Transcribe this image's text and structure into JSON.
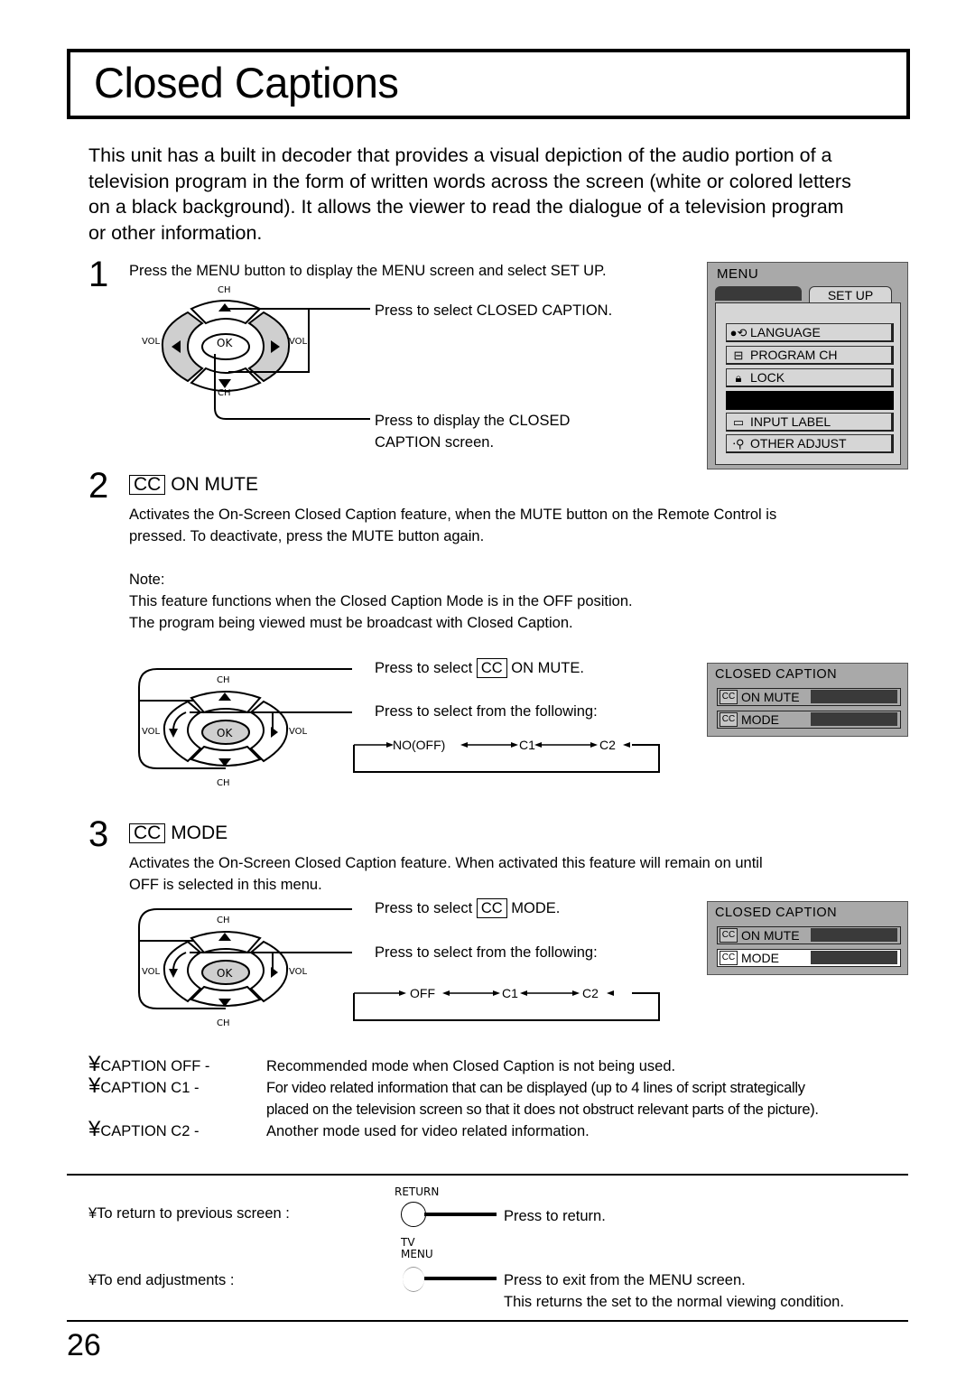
{
  "page": {
    "title": "Closed Captions",
    "intro": "This unit has a built in decoder that provides a visual depiction of the audio portion of a television program in the form of written words across the screen (white or colored letters on a black background). It allows the viewer to read the dialogue of a television program or other information.",
    "page_number": "26"
  },
  "step1": {
    "number": "1",
    "text": "Press the MENU button to display the MENU screen and select SET UP.",
    "callout_select": "Press to select CLOSED CAPTION.",
    "callout_display_line1": "Press to display the CLOSED",
    "callout_display_line2": "CAPTION screen.",
    "remote": {
      "ch_up": "CH",
      "ch_down": "CH",
      "vol_left": "VOL",
      "vol_right": "VOL",
      "ok": "OK"
    },
    "menu_screen": {
      "title": "MENU",
      "active_tab": "SET UP",
      "items": [
        {
          "icon": "language-icon",
          "label": "LANGUAGE"
        },
        {
          "icon": "program-ch-icon",
          "label": "PROGRAM  CH"
        },
        {
          "icon": "lock-icon",
          "label": "LOCK"
        },
        {
          "icon": "",
          "label": ""
        },
        {
          "icon": "input-label-icon",
          "label": "INPUT  LABEL"
        },
        {
          "icon": "other-adjust-icon",
          "label": "OTHER  ADJUST"
        }
      ]
    }
  },
  "step2": {
    "number": "2",
    "cc": "CC",
    "heading": "ON MUTE",
    "desc_line1": "Activates the On-Screen Closed Caption feature, when the MUTE button on the Remote Control is",
    "desc_line2": "pressed. To deactivate, press the MUTE button again.",
    "note_label": "Note:",
    "note_line1": "This feature functions when the Closed Caption Mode is in the  OFF  position.",
    "note_line2": "The program being viewed must be broadcast with Closed Caption.",
    "callout_select_prefix": "Press to select",
    "callout_select_suffix": "ON MUTE.",
    "callout_options": "Press to select from the following:",
    "cycle": [
      "NO(OFF)",
      "C1",
      "C2"
    ],
    "osd": {
      "title": "CLOSED  CAPTION",
      "rows": [
        {
          "icon": "cc",
          "label": "ON MUTE",
          "selected": false
        },
        {
          "icon": "cc",
          "label": "MODE",
          "selected": false
        }
      ]
    }
  },
  "step3": {
    "number": "3",
    "cc": "CC",
    "heading": "MODE",
    "desc_line1": "Activates the On-Screen Closed Caption feature. When activated this feature will remain on until",
    "desc_line2": "OFF is selected in this menu.",
    "callout_select_prefix": "Press to select",
    "callout_select_suffix": "MODE.",
    "callout_options": "Press to select from the following:",
    "cycle": [
      "OFF",
      "C1",
      "C2"
    ],
    "osd": {
      "title": "CLOSED  CAPTION",
      "rows": [
        {
          "icon": "cc",
          "label": "ON MUTE",
          "selected": false
        },
        {
          "icon": "cc",
          "label": "MODE",
          "selected": true
        }
      ]
    }
  },
  "modes": [
    {
      "bullet": "¥",
      "term": "CAPTION OFF -",
      "desc": "Recommended mode when Closed Caption is not being used."
    },
    {
      "bullet": "¥",
      "term": "CAPTION C1 -",
      "desc": "For video related information that can be displayed (up to 4 lines of script strategically",
      "desc2": "placed on the television screen so that it does not obstruct relevant parts of the picture)."
    },
    {
      "bullet": "¥",
      "term": "CAPTION C2 -",
      "desc": "Another mode used for video related information."
    }
  ],
  "footer": {
    "return_label": "¥To return to previous screen :",
    "return_button": "RETURN",
    "return_desc": "Press to return.",
    "end_label": "¥To end adjustments :",
    "menu_button_line1": "TV",
    "menu_button_line2": "MENU",
    "end_desc_line1": "Press to exit from the MENU screen.",
    "end_desc_line2": "This returns the set to the normal viewing condition."
  }
}
